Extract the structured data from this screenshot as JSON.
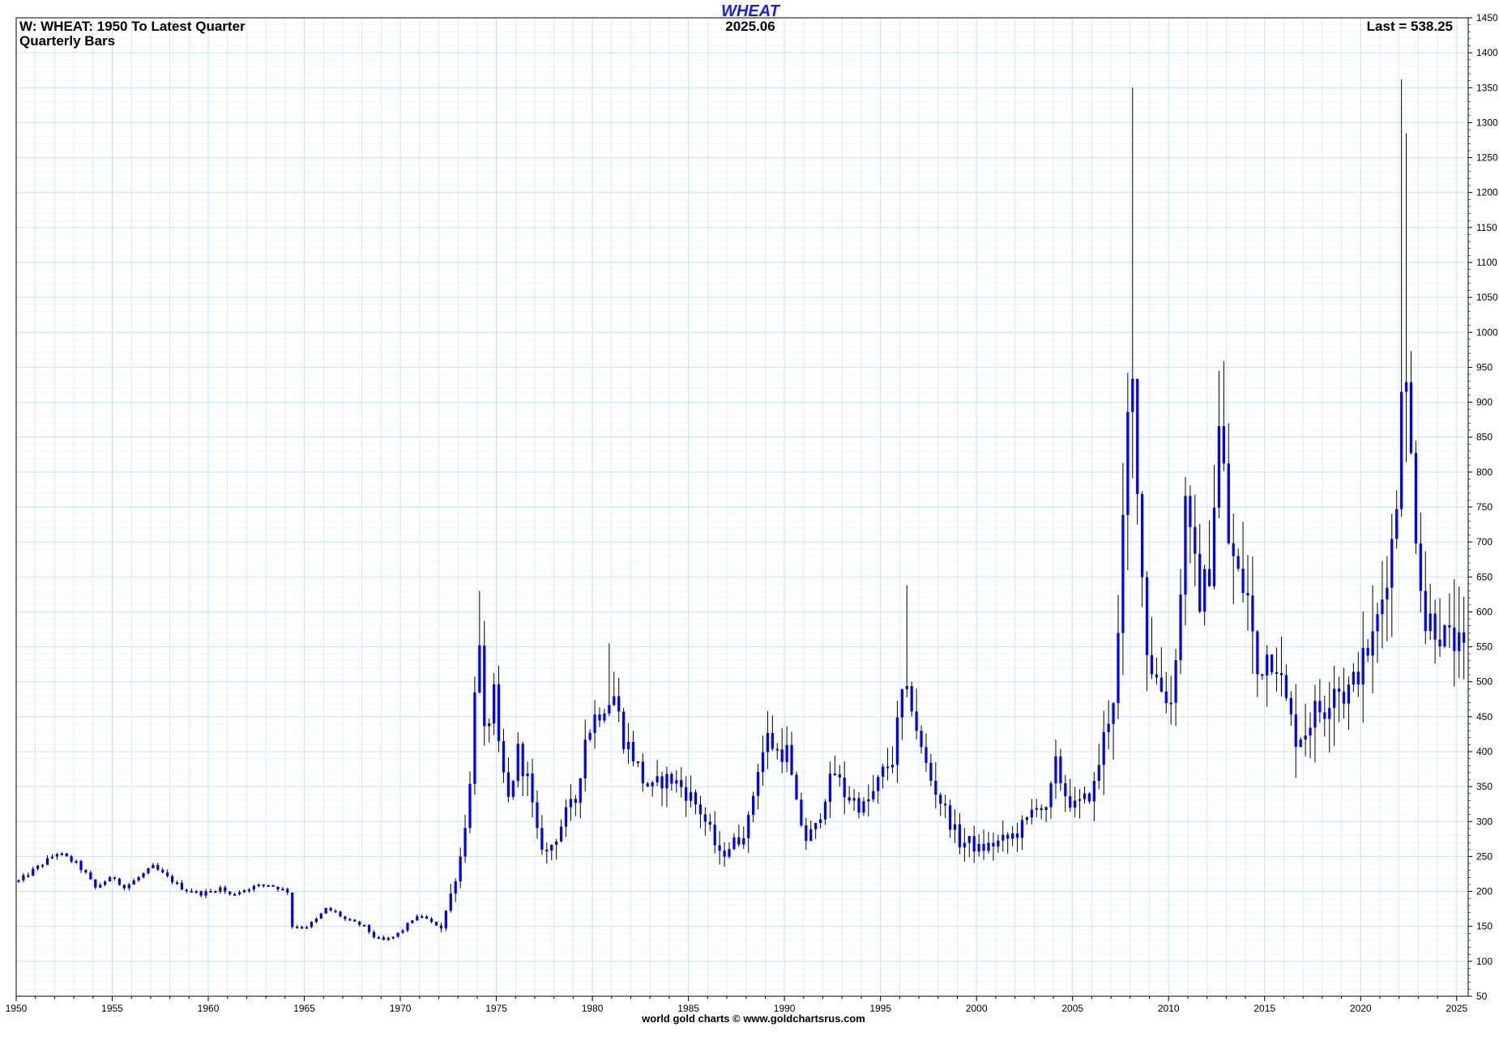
{
  "header": {
    "title": "WHEAT",
    "subtitle_left_1": "W: WHEAT: 1950 To Latest Quarter",
    "subtitle_left_2": "Quarterly Bars",
    "center_label": "2025.06",
    "last_label": "Last = 538.25"
  },
  "footer": {
    "credit": "world gold charts © www.goldchartsrus.com"
  },
  "colors": {
    "bar": "#0000ff",
    "wick": "#000000",
    "grid": "#bfe3f7",
    "title": "#1a1aff"
  },
  "chart_data": {
    "type": "ohlc-candlestick",
    "frequency": "quarterly",
    "ylim": [
      50,
      1450
    ],
    "y_scale": "linear",
    "y_ticks": [
      50,
      100,
      150,
      200,
      250,
      300,
      350,
      400,
      450,
      500,
      550,
      600,
      650,
      700,
      750,
      800,
      850,
      900,
      950,
      1000,
      1050,
      1100,
      1150,
      1200,
      1250,
      1300,
      1350,
      1400,
      1450
    ],
    "x_ticks": [
      "1950",
      "1955",
      "1960",
      "1965",
      "1970",
      "1975",
      "1980",
      "1985",
      "1990",
      "1995",
      "2000",
      "2005",
      "2010",
      "2015",
      "2020",
      "2025"
    ],
    "xlim": [
      1950,
      2025.6
    ],
    "grid": true,
    "last": 538.25,
    "anchors": [
      [
        1950.0,
        215
      ],
      [
        1950.5,
        225
      ],
      [
        1951.0,
        235
      ],
      [
        1951.5,
        245
      ],
      [
        1952.0,
        255
      ],
      [
        1952.5,
        248
      ],
      [
        1953.0,
        240
      ],
      [
        1953.5,
        225
      ],
      [
        1954.0,
        205
      ],
      [
        1954.5,
        215
      ],
      [
        1955.0,
        220
      ],
      [
        1955.5,
        205
      ],
      [
        1956.0,
        215
      ],
      [
        1956.5,
        225
      ],
      [
        1957.0,
        235
      ],
      [
        1957.5,
        225
      ],
      [
        1958.0,
        215
      ],
      [
        1958.5,
        205
      ],
      [
        1959.0,
        200
      ],
      [
        1959.5,
        197
      ],
      [
        1960.0,
        200
      ],
      [
        1960.5,
        205
      ],
      [
        1961.0,
        195
      ],
      [
        1961.5,
        200
      ],
      [
        1962.0,
        205
      ],
      [
        1962.5,
        208
      ],
      [
        1963.0,
        210
      ],
      [
        1963.5,
        205
      ],
      [
        1964.0,
        200
      ],
      [
        1964.25,
        150
      ],
      [
        1965.0,
        150
      ],
      [
        1965.5,
        160
      ],
      [
        1966.0,
        175
      ],
      [
        1966.5,
        170
      ],
      [
        1967.0,
        160
      ],
      [
        1967.5,
        155
      ],
      [
        1968.0,
        150
      ],
      [
        1968.5,
        135
      ],
      [
        1969.0,
        130
      ],
      [
        1969.5,
        135
      ],
      [
        1970.0,
        145
      ],
      [
        1970.5,
        160
      ],
      [
        1971.0,
        165
      ],
      [
        1971.5,
        155
      ],
      [
        1972.0,
        150
      ],
      [
        1972.5,
        195
      ],
      [
        1973.0,
        250
      ],
      [
        1973.5,
        350
      ],
      [
        1973.75,
        500
      ],
      [
        1974.0,
        540
      ],
      [
        1974.25,
        420
      ],
      [
        1974.75,
        480
      ],
      [
        1975.0,
        400
      ],
      [
        1975.5,
        330
      ],
      [
        1976.0,
        400
      ],
      [
        1976.5,
        360
      ],
      [
        1977.0,
        280
      ],
      [
        1977.5,
        255
      ],
      [
        1978.0,
        280
      ],
      [
        1978.5,
        310
      ],
      [
        1979.0,
        330
      ],
      [
        1979.5,
        420
      ],
      [
        1980.0,
        450
      ],
      [
        1980.5,
        470
      ],
      [
        1981.0,
        480
      ],
      [
        1981.5,
        420
      ],
      [
        1982.0,
        395
      ],
      [
        1982.5,
        360
      ],
      [
        1983.0,
        345
      ],
      [
        1983.5,
        360
      ],
      [
        1984.0,
        360
      ],
      [
        1984.5,
        350
      ],
      [
        1985.0,
        335
      ],
      [
        1985.5,
        315
      ],
      [
        1986.0,
        285
      ],
      [
        1986.5,
        250
      ],
      [
        1987.0,
        265
      ],
      [
        1987.5,
        275
      ],
      [
        1988.0,
        300
      ],
      [
        1988.5,
        380
      ],
      [
        1989.0,
        420
      ],
      [
        1989.5,
        400
      ],
      [
        1990.0,
        400
      ],
      [
        1990.5,
        320
      ],
      [
        1991.0,
        275
      ],
      [
        1991.5,
        290
      ],
      [
        1992.0,
        340
      ],
      [
        1992.5,
        370
      ],
      [
        1993.0,
        340
      ],
      [
        1993.5,
        330
      ],
      [
        1994.0,
        320
      ],
      [
        1994.5,
        340
      ],
      [
        1995.0,
        370
      ],
      [
        1995.5,
        390
      ],
      [
        1996.0,
        480
      ],
      [
        1996.5,
        470
      ],
      [
        1997.0,
        400
      ],
      [
        1997.5,
        360
      ],
      [
        1998.0,
        330
      ],
      [
        1998.5,
        300
      ],
      [
        1999.0,
        270
      ],
      [
        1999.5,
        270
      ],
      [
        2000.0,
        260
      ],
      [
        2000.5,
        265
      ],
      [
        2001.0,
        270
      ],
      [
        2001.5,
        275
      ],
      [
        2002.0,
        285
      ],
      [
        2002.5,
        300
      ],
      [
        2003.0,
        330
      ],
      [
        2003.5,
        310
      ],
      [
        2004.0,
        380
      ],
      [
        2004.5,
        340
      ],
      [
        2005.0,
        320
      ],
      [
        2005.5,
        330
      ],
      [
        2006.0,
        350
      ],
      [
        2006.5,
        420
      ],
      [
        2007.0,
        480
      ],
      [
        2007.25,
        560
      ],
      [
        2007.75,
        870
      ],
      [
        2008.0,
        920
      ],
      [
        2008.25,
        800
      ],
      [
        2008.5,
        650
      ],
      [
        2008.75,
        550
      ],
      [
        2009.0,
        520
      ],
      [
        2009.5,
        490
      ],
      [
        2010.0,
        470
      ],
      [
        2010.5,
        620
      ],
      [
        2010.75,
        780
      ],
      [
        2011.0,
        700
      ],
      [
        2011.5,
        620
      ],
      [
        2012.0,
        660
      ],
      [
        2012.5,
        860
      ],
      [
        2012.75,
        800
      ],
      [
        2013.0,
        700
      ],
      [
        2013.5,
        650
      ],
      [
        2014.0,
        620
      ],
      [
        2014.5,
        510
      ],
      [
        2015.0,
        540
      ],
      [
        2015.5,
        530
      ],
      [
        2016.0,
        470
      ],
      [
        2016.5,
        420
      ],
      [
        2017.0,
        430
      ],
      [
        2017.5,
        460
      ],
      [
        2018.0,
        460
      ],
      [
        2018.5,
        500
      ],
      [
        2019.0,
        480
      ],
      [
        2019.5,
        500
      ],
      [
        2020.0,
        530
      ],
      [
        2020.5,
        560
      ],
      [
        2021.0,
        620
      ],
      [
        2021.5,
        700
      ],
      [
        2021.75,
        760
      ],
      [
        2022.0,
        950
      ],
      [
        2022.25,
        910
      ],
      [
        2022.5,
        820
      ],
      [
        2022.75,
        720
      ],
      [
        2023.0,
        650
      ],
      [
        2023.25,
        580
      ],
      [
        2023.5,
        590
      ],
      [
        2024.0,
        570
      ],
      [
        2024.5,
        560
      ],
      [
        2025.0,
        550
      ],
      [
        2025.25,
        538
      ]
    ],
    "notable_highs": [
      [
        1974.0,
        630
      ],
      [
        1980.75,
        555
      ],
      [
        1996.25,
        638
      ],
      [
        2008.0,
        1350
      ],
      [
        2012.5,
        945
      ],
      [
        2022.0,
        1362
      ],
      [
        2022.25,
        1285
      ]
    ]
  }
}
